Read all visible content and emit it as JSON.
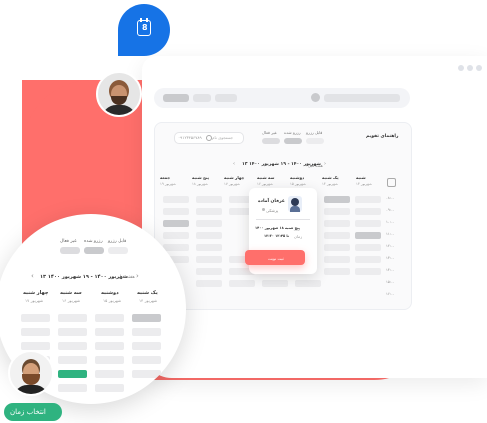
{
  "colors": {
    "brand": "#ff6b6b",
    "accent_blue": "#1673e6",
    "green": "#2fb380",
    "panel": "#f3f4f7",
    "cell": "#ececee",
    "cell_dark": "#c9cacd"
  },
  "badge": {
    "number": "8",
    "icon": "calendar-icon"
  },
  "panel": {
    "title": "راهنمای تقویم",
    "legend": [
      {
        "label": "قابل رزرو"
      },
      {
        "label": "رزرو شده"
      },
      {
        "label": "غیر فعال"
      }
    ],
    "search_placeholder": "جستجوی نام",
    "phone": "۰۹۱۲۳۴۵۶۷۸۹",
    "date_range": "۱۳ شهریور ۱۴۰۰ - ۱۹ شهریور ۱۴۰۰",
    "prev_label": "هفته قبل",
    "day_names": [
      "شنبه",
      "یک شنبه",
      "دوشنبه",
      "سه شنبه",
      "چهار شنبه",
      "پنج شنبه",
      "جمعه"
    ],
    "day_dates": [
      "۱۳ شهریور",
      "۱۴ شهریور",
      "۱۵ شهریور",
      "۱۶ شهریور",
      "۱۷ شهریور",
      "۱۸ شهریور",
      "۱۹ شهریور"
    ],
    "times": [
      "۰۸:۰۰",
      "۰۹:۰۰",
      "۱۰:۰۰",
      "۱۱:۰۰",
      "۱۲:۰۰",
      "۱۳:۰۰",
      "۱۴:۰۰",
      "۱۵:۰۰",
      "۱۶:۰۰"
    ]
  },
  "popup": {
    "name": "عرفان آماده",
    "subtitle": "پزشکی",
    "day_label": "روز",
    "day_value": "پنج شنبه ۱۸ شهریور ۱۴۰۰",
    "time_label": "زمان",
    "time_value": "۱۲:۳۰ تا ۱۲:۴۵",
    "button": "ثبت نوبت"
  },
  "zoom": {
    "legend": [
      {
        "label": "قابل رزرو"
      },
      {
        "label": "رزرو شده"
      },
      {
        "label": "غیر فعال"
      }
    ],
    "date_range": "۱۳ شهریور ۱۴۰۰ - ۱۹ شهریور ۱۴۰۰",
    "prev_label": "هفته قبل",
    "day_names": [
      "یک شنبه",
      "دوشنبه",
      "سه شنبه",
      "چهار شنبه"
    ],
    "day_dates": [
      "۱۴ شهریور",
      "۱۵ شهریور",
      "۱۶ شهریور",
      "۱۷ شهریور"
    ]
  },
  "cta": {
    "label": "انتخاب زمان"
  }
}
